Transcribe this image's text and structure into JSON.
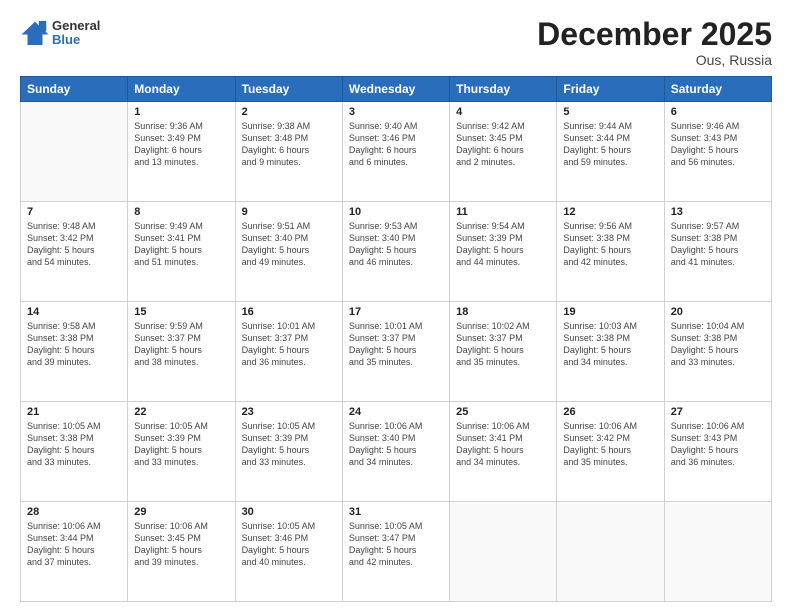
{
  "header": {
    "logo": {
      "general": "General",
      "blue": "Blue"
    },
    "title": "December 2025",
    "location": "Ous, Russia"
  },
  "weekdays": [
    "Sunday",
    "Monday",
    "Tuesday",
    "Wednesday",
    "Thursday",
    "Friday",
    "Saturday"
  ],
  "weeks": [
    [
      {
        "day": "",
        "info": ""
      },
      {
        "day": "1",
        "info": "Sunrise: 9:36 AM\nSunset: 3:49 PM\nDaylight: 6 hours\nand 13 minutes."
      },
      {
        "day": "2",
        "info": "Sunrise: 9:38 AM\nSunset: 3:48 PM\nDaylight: 6 hours\nand 9 minutes."
      },
      {
        "day": "3",
        "info": "Sunrise: 9:40 AM\nSunset: 3:46 PM\nDaylight: 6 hours\nand 6 minutes."
      },
      {
        "day": "4",
        "info": "Sunrise: 9:42 AM\nSunset: 3:45 PM\nDaylight: 6 hours\nand 2 minutes."
      },
      {
        "day": "5",
        "info": "Sunrise: 9:44 AM\nSunset: 3:44 PM\nDaylight: 5 hours\nand 59 minutes."
      },
      {
        "day": "6",
        "info": "Sunrise: 9:46 AM\nSunset: 3:43 PM\nDaylight: 5 hours\nand 56 minutes."
      }
    ],
    [
      {
        "day": "7",
        "info": "Sunrise: 9:48 AM\nSunset: 3:42 PM\nDaylight: 5 hours\nand 54 minutes."
      },
      {
        "day": "8",
        "info": "Sunrise: 9:49 AM\nSunset: 3:41 PM\nDaylight: 5 hours\nand 51 minutes."
      },
      {
        "day": "9",
        "info": "Sunrise: 9:51 AM\nSunset: 3:40 PM\nDaylight: 5 hours\nand 49 minutes."
      },
      {
        "day": "10",
        "info": "Sunrise: 9:53 AM\nSunset: 3:40 PM\nDaylight: 5 hours\nand 46 minutes."
      },
      {
        "day": "11",
        "info": "Sunrise: 9:54 AM\nSunset: 3:39 PM\nDaylight: 5 hours\nand 44 minutes."
      },
      {
        "day": "12",
        "info": "Sunrise: 9:56 AM\nSunset: 3:38 PM\nDaylight: 5 hours\nand 42 minutes."
      },
      {
        "day": "13",
        "info": "Sunrise: 9:57 AM\nSunset: 3:38 PM\nDaylight: 5 hours\nand 41 minutes."
      }
    ],
    [
      {
        "day": "14",
        "info": "Sunrise: 9:58 AM\nSunset: 3:38 PM\nDaylight: 5 hours\nand 39 minutes."
      },
      {
        "day": "15",
        "info": "Sunrise: 9:59 AM\nSunset: 3:37 PM\nDaylight: 5 hours\nand 38 minutes."
      },
      {
        "day": "16",
        "info": "Sunrise: 10:01 AM\nSunset: 3:37 PM\nDaylight: 5 hours\nand 36 minutes."
      },
      {
        "day": "17",
        "info": "Sunrise: 10:01 AM\nSunset: 3:37 PM\nDaylight: 5 hours\nand 35 minutes."
      },
      {
        "day": "18",
        "info": "Sunrise: 10:02 AM\nSunset: 3:37 PM\nDaylight: 5 hours\nand 35 minutes."
      },
      {
        "day": "19",
        "info": "Sunrise: 10:03 AM\nSunset: 3:38 PM\nDaylight: 5 hours\nand 34 minutes."
      },
      {
        "day": "20",
        "info": "Sunrise: 10:04 AM\nSunset: 3:38 PM\nDaylight: 5 hours\nand 33 minutes."
      }
    ],
    [
      {
        "day": "21",
        "info": "Sunrise: 10:05 AM\nSunset: 3:38 PM\nDaylight: 5 hours\nand 33 minutes."
      },
      {
        "day": "22",
        "info": "Sunrise: 10:05 AM\nSunset: 3:39 PM\nDaylight: 5 hours\nand 33 minutes."
      },
      {
        "day": "23",
        "info": "Sunrise: 10:05 AM\nSunset: 3:39 PM\nDaylight: 5 hours\nand 33 minutes."
      },
      {
        "day": "24",
        "info": "Sunrise: 10:06 AM\nSunset: 3:40 PM\nDaylight: 5 hours\nand 34 minutes."
      },
      {
        "day": "25",
        "info": "Sunrise: 10:06 AM\nSunset: 3:41 PM\nDaylight: 5 hours\nand 34 minutes."
      },
      {
        "day": "26",
        "info": "Sunrise: 10:06 AM\nSunset: 3:42 PM\nDaylight: 5 hours\nand 35 minutes."
      },
      {
        "day": "27",
        "info": "Sunrise: 10:06 AM\nSunset: 3:43 PM\nDaylight: 5 hours\nand 36 minutes."
      }
    ],
    [
      {
        "day": "28",
        "info": "Sunrise: 10:06 AM\nSunset: 3:44 PM\nDaylight: 5 hours\nand 37 minutes."
      },
      {
        "day": "29",
        "info": "Sunrise: 10:06 AM\nSunset: 3:45 PM\nDaylight: 5 hours\nand 39 minutes."
      },
      {
        "day": "30",
        "info": "Sunrise: 10:05 AM\nSunset: 3:46 PM\nDaylight: 5 hours\nand 40 minutes."
      },
      {
        "day": "31",
        "info": "Sunrise: 10:05 AM\nSunset: 3:47 PM\nDaylight: 5 hours\nand 42 minutes."
      },
      {
        "day": "",
        "info": ""
      },
      {
        "day": "",
        "info": ""
      },
      {
        "day": "",
        "info": ""
      }
    ]
  ]
}
